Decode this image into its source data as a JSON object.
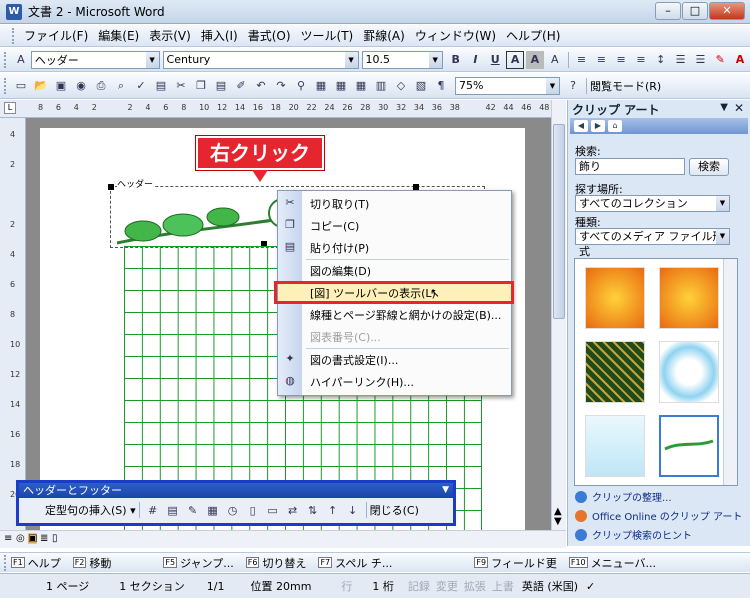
{
  "window": {
    "title": "文書 2 - Microsoft Word",
    "app_icon": "W"
  },
  "menu": [
    "ファイル(F)",
    "編集(E)",
    "表示(V)",
    "挿入(I)",
    "書式(O)",
    "ツール(T)",
    "罫線(A)",
    "ウィンドウ(W)",
    "ヘルプ(H)"
  ],
  "format_toolbar": {
    "style": "ヘッダー",
    "font": "Century",
    "size": "10.5"
  },
  "standard_toolbar": {
    "zoom": "75%",
    "reading_mode": "閲覧モード(R)"
  },
  "ruler": {
    "numbers": [
      "8",
      "6",
      "4",
      "2",
      "",
      "2",
      "4",
      "6",
      "8",
      "10",
      "12",
      "14",
      "16",
      "18",
      "20",
      "22",
      "24",
      "26",
      "28",
      "30",
      "32",
      "34",
      "36",
      "38",
      "",
      "42",
      "44",
      "46",
      "48"
    ]
  },
  "vruler": {
    "numbers": [
      "4",
      "2",
      "",
      "2",
      "4",
      "6",
      "8",
      "10",
      "12",
      "14",
      "16",
      "18",
      "20"
    ]
  },
  "document": {
    "header_label": "ヘッダー"
  },
  "callout": {
    "text": "右クリック"
  },
  "context_menu": {
    "items": [
      {
        "label": "切り取り(T)",
        "icon": "scissors-icon",
        "enabled": true
      },
      {
        "label": "コピー(C)",
        "icon": "copy-icon",
        "enabled": true
      },
      {
        "label": "貼り付け(P)",
        "icon": "paste-icon",
        "enabled": true
      },
      {
        "label": "図の編集(D)",
        "icon": "",
        "enabled": true
      },
      {
        "label": "[図] ツールバーの表示(L)",
        "icon": "",
        "enabled": true,
        "highlighted": true
      },
      {
        "label": "線種とページ罫線と網かけの設定(B)...",
        "icon": "",
        "enabled": true
      },
      {
        "label": "図表番号(C)...",
        "icon": "",
        "enabled": false
      },
      {
        "label": "図の書式設定(I)...",
        "icon": "format-picture-icon",
        "enabled": true
      },
      {
        "label": "ハイパーリンク(H)...",
        "icon": "hyperlink-icon",
        "enabled": true
      }
    ]
  },
  "header_footer_toolbar": {
    "title": "ヘッダーとフッター",
    "insert_autotext": "定型句の挿入(S)",
    "close": "閉じる(C)"
  },
  "clipart_pane": {
    "title": "クリップ アート",
    "search_label": "検索:",
    "search_value": "飾り",
    "search_button": "検索",
    "location_label": "探す場所:",
    "location_value": "すべてのコレクション",
    "type_label": "種類:",
    "type_value": "すべてのメディア ファイル形式",
    "links": [
      "クリップの整理...",
      "Office Online のクリップ アート",
      "クリップ検索のヒント"
    ]
  },
  "fkeys": [
    {
      "key": "F1",
      "label": "ヘルプ"
    },
    {
      "key": "F2",
      "label": "移動"
    },
    {
      "key": "F5",
      "label": "ジャンプ..."
    },
    {
      "key": "F6",
      "label": "切り替え"
    },
    {
      "key": "F7",
      "label": "スペル チ..."
    },
    {
      "key": "F9",
      "label": "フィールド更"
    },
    {
      "key": "F10",
      "label": "メニューバ..."
    }
  ],
  "status": {
    "page": "1 ページ",
    "section": "1 セクション",
    "pages": "1/1",
    "position": "位置 20mm",
    "line": "行",
    "column": "1 桁",
    "rec": "記録",
    "trk": "変更",
    "ext": "拡張",
    "ovr": "上書",
    "lang": "英語 (米国)"
  },
  "colors": {
    "accent_red": "#e6262e",
    "grid_green": "#1a9a2a",
    "toolbar_blue": "#1a3cc8"
  }
}
